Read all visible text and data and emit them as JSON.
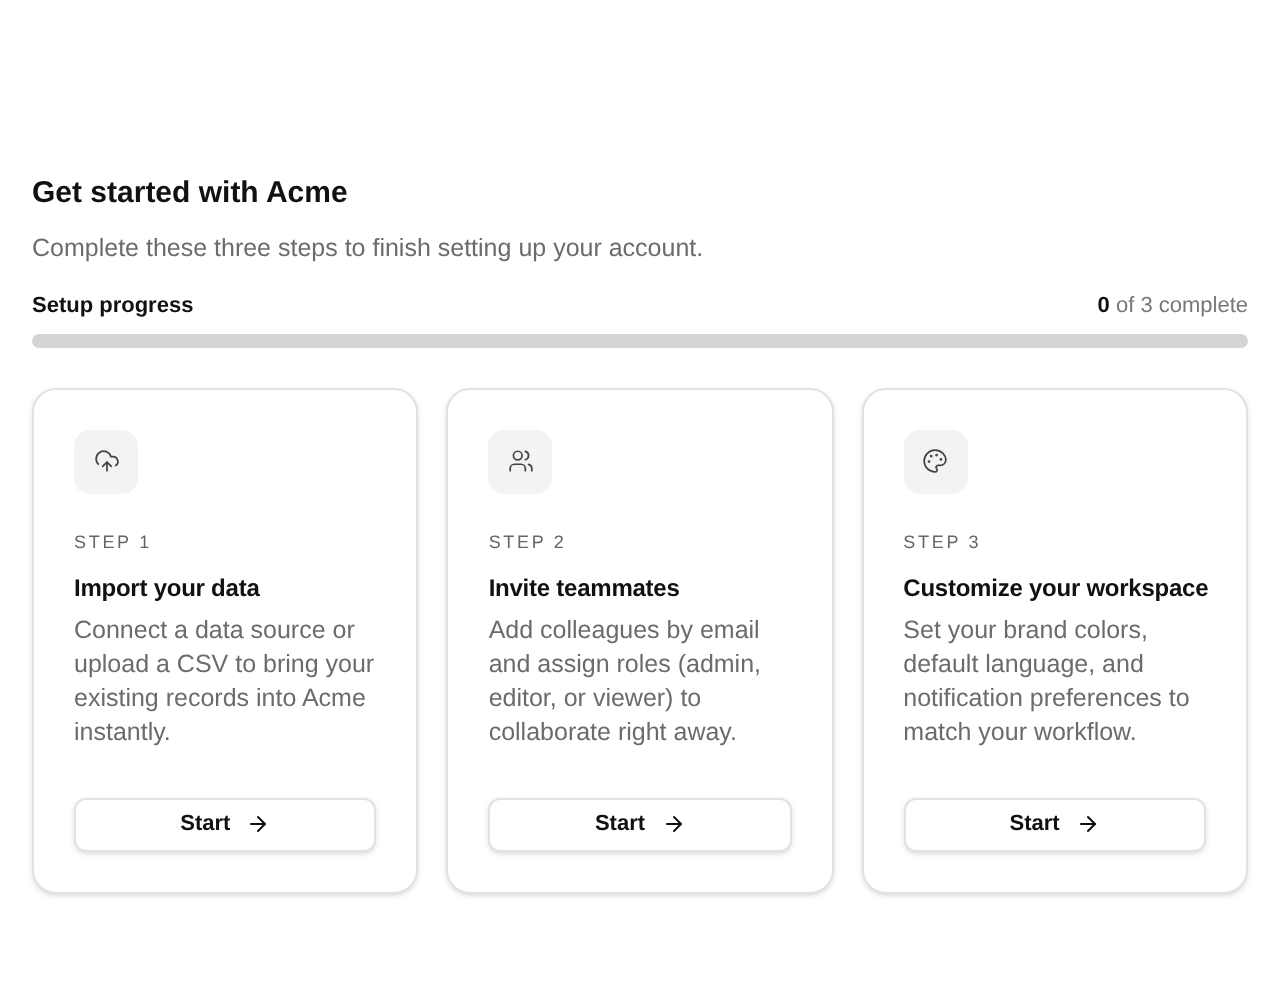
{
  "header": {
    "title": "Get started with Acme",
    "subtitle": "Complete these three steps to finish setting up your account."
  },
  "progress": {
    "label": "Setup progress",
    "count": "**0** of 3 complete",
    "level": 0
  },
  "steps": [
    {
      "kind": "upload",
      "step": "STEP 1",
      "title": "Import your data",
      "description": "Connect a data source or upload a CSV to bring your existing records into Acme instantly.",
      "button": "Start"
    },
    {
      "kind": "users",
      "step": "STEP 2",
      "title": "Invite teammates",
      "description": "Add colleagues by email and assign roles (admin, editor, or viewer) to collaborate right away.",
      "button": "Start"
    },
    {
      "kind": "palette",
      "step": "STEP 3",
      "title": "Customize your workspace",
      "description": "Set your brand colors, default language, and notification preferences to match your workflow.",
      "button": "Start"
    }
  ]
}
